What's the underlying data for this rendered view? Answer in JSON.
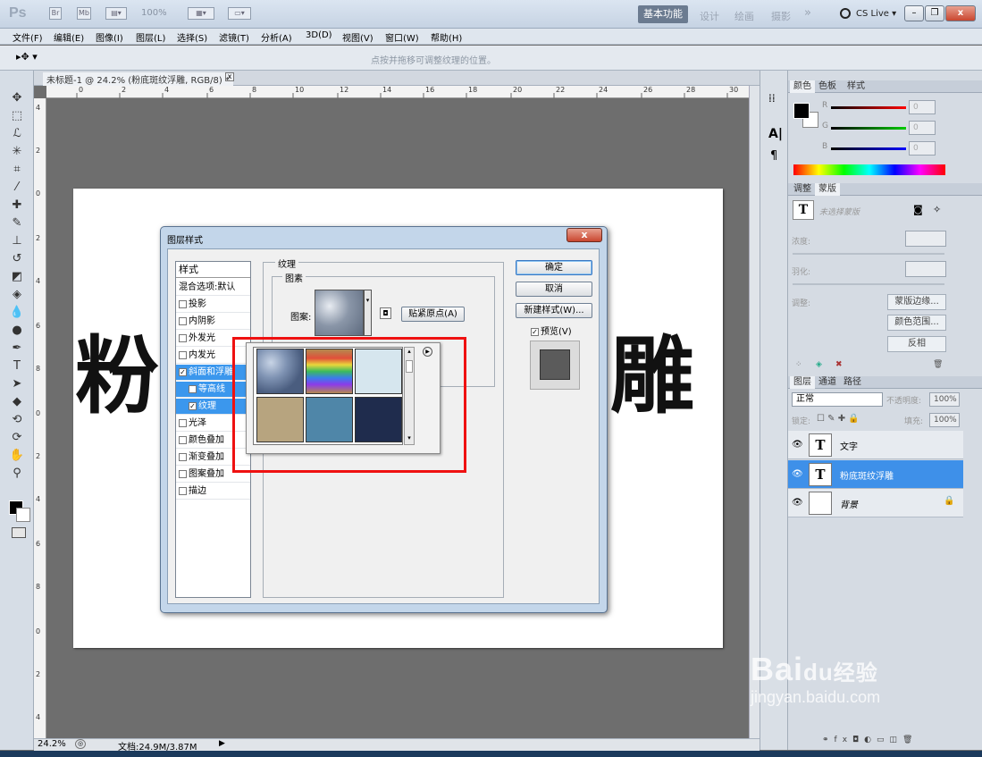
{
  "app": {
    "logo": "Ps",
    "zoom": "100%"
  },
  "workspace": {
    "active": "基本功能",
    "items": [
      "设计",
      "绘画",
      "摄影"
    ],
    "more": "»",
    "cs_live": "CS Live ▾"
  },
  "menu": [
    "文件(F)",
    "编辑(E)",
    "图像(I)",
    "图层(L)",
    "选择(S)",
    "滤镜(T)",
    "分析(A)",
    "3D(D)",
    "视图(V)",
    "窗口(W)",
    "帮助(H)"
  ],
  "options_hint": "点按并拖移可调整纹理的位置。",
  "document": {
    "tab_title": "未标题-1 @ 24.2% (粉底斑纹浮雕, RGB/8) *",
    "ruler_h": [
      "0",
      "2",
      "4",
      "6",
      "8",
      "10",
      "12",
      "14",
      "16",
      "18",
      "20",
      "22",
      "24",
      "26",
      "28",
      "30"
    ],
    "ruler_v": [
      "4",
      "2",
      "0",
      "2",
      "4",
      "6",
      "8",
      "0",
      "2",
      "4",
      "6",
      "8",
      "0",
      "2",
      "4"
    ],
    "text_left": "粉",
    "text_right": "雕"
  },
  "status": {
    "zoom": "24.2%",
    "doc_size": "文档:24.9M/3.87M"
  },
  "panels": {
    "color_tabs": [
      "颜色",
      "色板",
      "样式"
    ],
    "color_labels": [
      "R",
      "G",
      "B"
    ],
    "color_values": [
      "0",
      "0",
      "0"
    ],
    "adjust_tabs": [
      "调整",
      "蒙版"
    ],
    "mask_status": "未选择蒙版",
    "density_label": "浓度:",
    "feather_label": "羽化:",
    "refine_label": "调整:",
    "mask_edge_btn": "蒙版边缘...",
    "color_range_btn": "颜色范围...",
    "invert_btn": "反相",
    "layer_tabs": [
      "图层",
      "通道",
      "路径"
    ],
    "blend_mode": "正常",
    "opacity_label": "不透明度:",
    "opacity": "100%",
    "lock_label": "锁定:",
    "fill_label": "填充:",
    "fill": "100%",
    "layers": [
      {
        "name": "文字",
        "thumb": "T",
        "selected": false
      },
      {
        "name": "粉底斑纹浮雕",
        "thumb": "T",
        "selected": true
      },
      {
        "name": "背景",
        "thumb": "",
        "selected": false
      }
    ]
  },
  "dialog": {
    "title": "图层样式",
    "close": "x",
    "styles_header": "样式",
    "blend_options": "混合选项:默认",
    "items": [
      {
        "label": "投影",
        "checked": false
      },
      {
        "label": "内阴影",
        "checked": false
      },
      {
        "label": "外发光",
        "checked": false
      },
      {
        "label": "内发光",
        "checked": false
      },
      {
        "label": "斜面和浮雕",
        "checked": true
      },
      {
        "label": "等高线",
        "checked": false
      },
      {
        "label": "纹理",
        "checked": true
      },
      {
        "label": "光泽",
        "checked": false
      },
      {
        "label": "颜色叠加",
        "checked": false
      },
      {
        "label": "渐变叠加",
        "checked": false
      },
      {
        "label": "图案叠加",
        "checked": false
      },
      {
        "label": "描边",
        "checked": false
      }
    ],
    "section_title": "纹理",
    "subsection": "图素",
    "pattern_label": "图案:",
    "snap_origin": "贴紧原点(A)",
    "ok": "确定",
    "cancel": "取消",
    "new_style": "新建样式(W)...",
    "preview": "预览(V)"
  },
  "pattern_picker": {
    "swatch_colors": [
      "#7f93b3",
      "#b38a4f",
      "#d6e6ee",
      "#b7a47f",
      "#4f86a8",
      "#1f2c4d"
    ]
  },
  "watermark": {
    "logo": "Bai",
    "paw": "du",
    "cn": "经验",
    "url": "jingyan.baidu.com"
  }
}
